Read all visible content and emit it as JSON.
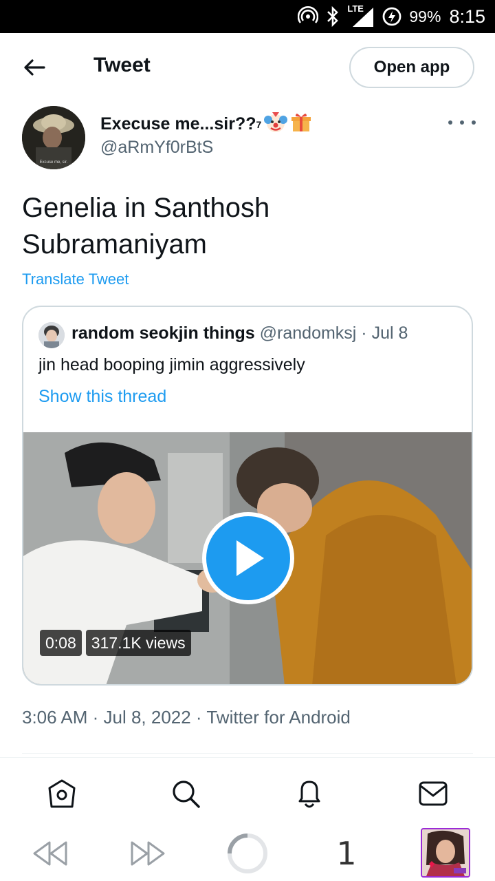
{
  "status_bar": {
    "network": "LTE",
    "battery": "99%",
    "time": "8:15"
  },
  "header": {
    "title": "Tweet",
    "open_app_label": "Open app"
  },
  "author": {
    "display_name": "Execuse me...sir??",
    "superscript": "7",
    "emojis": [
      "clown-emoji",
      "gift-emoji"
    ],
    "handle": "@aRmYf0rBtS",
    "avatar_caption": "Excuse me, sir."
  },
  "tweet": {
    "text": "Genelia in Santhosh Subramaniyam",
    "translate_label": "Translate Tweet",
    "timestamp": "3:06 AM · Jul 8, 2022 · Twitter for Android"
  },
  "quote": {
    "name": "random seokjin things",
    "handle_date": "@randomksj · Jul 8",
    "text": "jin head booping jimin aggressively",
    "show_thread_label": "Show this thread",
    "video": {
      "duration": "0:08",
      "views": "317.1K views"
    }
  },
  "bottom_nav": {
    "items": [
      "home-icon",
      "search-icon",
      "notifications-icon",
      "messages-icon"
    ]
  },
  "browser_bar": {
    "tab_count": "1",
    "items": [
      "back-icon",
      "forward-icon",
      "loading-icon"
    ]
  },
  "colors": {
    "accent": "#1d9bf0",
    "secondary_text": "#536471",
    "border": "#cfd9de"
  }
}
